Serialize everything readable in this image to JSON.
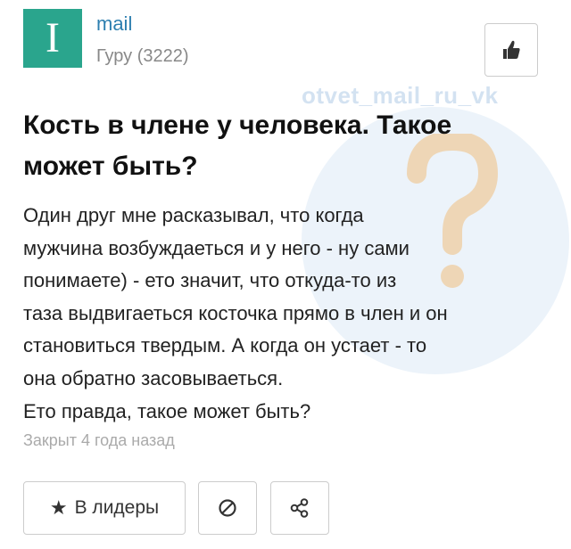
{
  "watermark": {
    "text": "otvet_mail_ru_vk"
  },
  "user": {
    "avatar_letter": "I",
    "name": "mail",
    "rank": "Гуру (3222)"
  },
  "question": {
    "title": "Кость в члене у человека. Такое может быть?",
    "body_lines": [
      "Один друг мне расказывал, что когда",
      "мужчина возбуждаеться и у него - ну сами",
      "понимаете) - ето значит, что откуда-то из",
      "таза выдвигаеться косточка прямо в член и он",
      "становиться твердым. А когда он устает - то",
      "она обратно засовываеться.",
      "Ето правда, такое может быть?"
    ],
    "status": "Закрыт 4 года назад"
  },
  "actions": {
    "leaders_label": "В лидеры",
    "leaders_icon": "star-icon",
    "block_icon": "block-icon",
    "share_icon": "share-icon",
    "like_icon": "thumbs-up-icon"
  },
  "colors": {
    "avatar_bg": "#2aa58d",
    "username": "#2d7fb0",
    "watermark": "#c9dbee"
  }
}
